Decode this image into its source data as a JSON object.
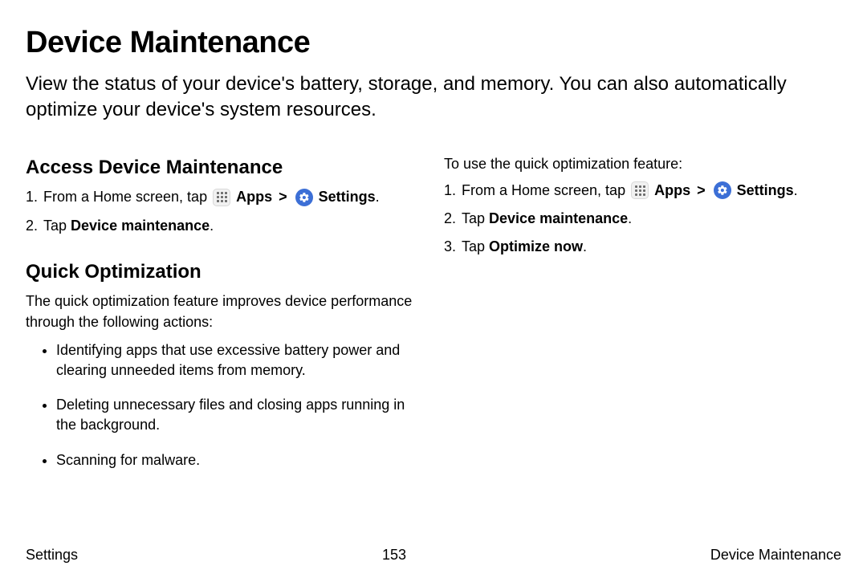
{
  "title": "Device Maintenance",
  "intro": "View the status of your device's battery, storage, and memory. You can also automatically optimize your device's system resources.",
  "left": {
    "h_access": "Access Device Maintenance",
    "step1_prefix": "From a Home screen, tap ",
    "apps_label": "Apps",
    "chev": ">",
    "settings_label": "Settings",
    "period": ".",
    "step2_prefix": "Tap ",
    "step2_bold": "Device maintenance",
    "h_quick": "Quick Optimization",
    "quick_intro": "The quick optimization feature improves device performance through the following actions:",
    "bullets": [
      "Identifying apps that use excessive battery power and clearing unneeded items from memory.",
      "Deleting unnecessary files and closing apps running in the background.",
      "Scanning for malware."
    ]
  },
  "right": {
    "lead": "To use the quick optimization feature:",
    "step1_prefix": "From a Home screen, tap ",
    "apps_label": "Apps",
    "chev": ">",
    "settings_label": "Settings",
    "period": ".",
    "step2_prefix": "Tap ",
    "step2_bold": "Device maintenance",
    "step3_prefix": "Tap ",
    "step3_bold": "Optimize now"
  },
  "nums": {
    "n1": "1.",
    "n2": "2.",
    "n3": "3."
  },
  "footer": {
    "left": "Settings",
    "center": "153",
    "right": "Device Maintenance"
  }
}
